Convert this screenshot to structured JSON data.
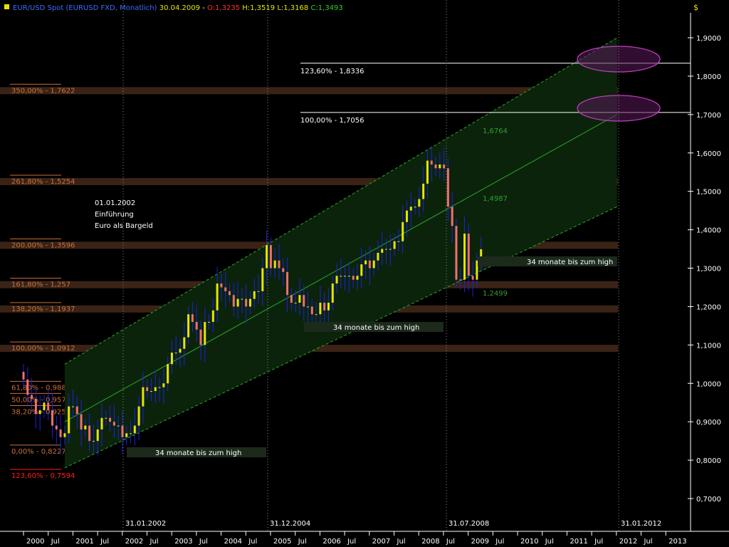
{
  "header": {
    "symbol": "EUR/USD Spot (EURUSD FXD, Monatlich)",
    "date": "30.04.2009",
    "open": "O:1,3235",
    "high": "H:1,3519",
    "low": "L:1,3168",
    "close": "C:1,3493",
    "currency": "$"
  },
  "colors": {
    "background": "#000000",
    "up_candle": "#e6e600",
    "down_candle": "#f07070",
    "wick": "#2020e0",
    "fib_band": "#3a2316",
    "channel_fill": "#0b230b",
    "channel_line": "#2ba62b",
    "ellipse": "#b030b0",
    "fib_text": "#c9703a",
    "red_text": "#ff2020"
  },
  "fib_levels": [
    {
      "label": "350,00% - 1,7622",
      "value": 1.7622
    },
    {
      "label": "261,80% - 1,5254",
      "value": 1.5254
    },
    {
      "label": "200,00% - 1,3596",
      "value": 1.3596
    },
    {
      "label": "161,80% - 1,257",
      "value": 1.257
    },
    {
      "label": "138,20% - 1,1937",
      "value": 1.1937
    },
    {
      "label": "100,00% - 1,0912",
      "value": 1.0912
    },
    {
      "label": "61,80% - 0,9886",
      "value": 0.9886
    },
    {
      "label": "50,00% - 0,957",
      "value": 0.957
    },
    {
      "label": "38,20% - 0,9253",
      "value": 0.9253
    },
    {
      "label": "0,00% - 0,8227",
      "value": 0.8227
    },
    {
      "label": "123,60% - 0,7594",
      "value": 0.7594,
      "color": "red"
    }
  ],
  "targets": [
    {
      "label": "123,60% - 1,8336",
      "value": 1.8336
    },
    {
      "label": "100,00% - 1,7056",
      "value": 1.7056
    }
  ],
  "annotations": {
    "euro_intro": [
      "01.01.2002",
      "Einführung",
      "Euro als Bargeld"
    ],
    "months_to_high_1": "34 monate bis zum high",
    "months_to_high_2": "34 monate bis zum high",
    "months_to_high_3": "34 monate bis zum high",
    "channel_1_6764": "1,6764",
    "channel_1_4987": "1,4987",
    "channel_1_2499": "1,2499",
    "date_2002": "31.01.2002",
    "date_2004": "31.12.2004",
    "date_2008": "31.07.2008",
    "date_2012": "31.01.2012"
  },
  "chart_data": {
    "type": "candlestick",
    "title": "EUR/USD Spot (EURUSD FXD, Monatlich)",
    "y_axis": {
      "ylim": [
        0.66,
        2.0
      ],
      "ticks": [
        "1,9000",
        "1,8000",
        "1,7000",
        "1,6000",
        "1,5000",
        "1,4000",
        "1,3000",
        "1,2000",
        "1,1000",
        "1,0000",
        "0,9000",
        "0,8000",
        "0,7000"
      ],
      "position": "right"
    },
    "x_axis": {
      "labels": [
        "2000",
        "Jul",
        "2001",
        "Jul",
        "2002",
        "Jul",
        "2003",
        "Jul",
        "2004",
        "Jul",
        "2005",
        "Jul",
        "2006",
        "Jul",
        "2007",
        "Jul",
        "2008",
        "Jul",
        "2009",
        "Jul",
        "2010",
        "Jul",
        "2011",
        "Jul",
        "2012",
        "Jul",
        "2013"
      ]
    },
    "series": [
      {
        "key": "close_monthly_2000_2009",
        "start": "2000-01",
        "interval": "month",
        "close": [
          1.01,
          0.97,
          0.96,
          0.92,
          0.93,
          0.95,
          0.93,
          0.89,
          0.88,
          0.86,
          0.87,
          0.94,
          0.94,
          0.92,
          0.88,
          0.89,
          0.85,
          0.85,
          0.88,
          0.91,
          0.91,
          0.9,
          0.89,
          0.89,
          0.86,
          0.87,
          0.87,
          0.89,
          0.94,
          0.99,
          0.98,
          0.98,
          0.99,
          0.99,
          1.0,
          1.05,
          1.08,
          1.08,
          1.09,
          1.12,
          1.18,
          1.16,
          1.14,
          1.1,
          1.16,
          1.16,
          1.19,
          1.26,
          1.25,
          1.24,
          1.23,
          1.2,
          1.22,
          1.22,
          1.2,
          1.22,
          1.24,
          1.24,
          1.3,
          1.36,
          1.3,
          1.32,
          1.3,
          1.29,
          1.23,
          1.21,
          1.21,
          1.23,
          1.2,
          1.2,
          1.18,
          1.18,
          1.21,
          1.19,
          1.21,
          1.26,
          1.28,
          1.28,
          1.28,
          1.28,
          1.27,
          1.28,
          1.31,
          1.32,
          1.3,
          1.32,
          1.34,
          1.35,
          1.35,
          1.35,
          1.37,
          1.37,
          1.42,
          1.45,
          1.46,
          1.46,
          1.48,
          1.52,
          1.58,
          1.57,
          1.56,
          1.57,
          1.56,
          1.46,
          1.41,
          1.27,
          1.27,
          1.39,
          1.28,
          1.27,
          1.32,
          1.3493
        ]
      }
    ],
    "channel": {
      "lines": [
        {
          "name": "upper",
          "from": [
            "2000-11",
            1.05
          ],
          "to": [
            "2012-01",
            1.9
          ]
        },
        {
          "name": "middle",
          "from": [
            "2000-11",
            0.9
          ],
          "to": [
            "2012-01",
            1.7
          ]
        },
        {
          "name": "lower",
          "from": [
            "2000-11",
            0.78
          ],
          "to": [
            "2012-01",
            1.46
          ]
        }
      ]
    },
    "grid": false,
    "legend": "none"
  }
}
